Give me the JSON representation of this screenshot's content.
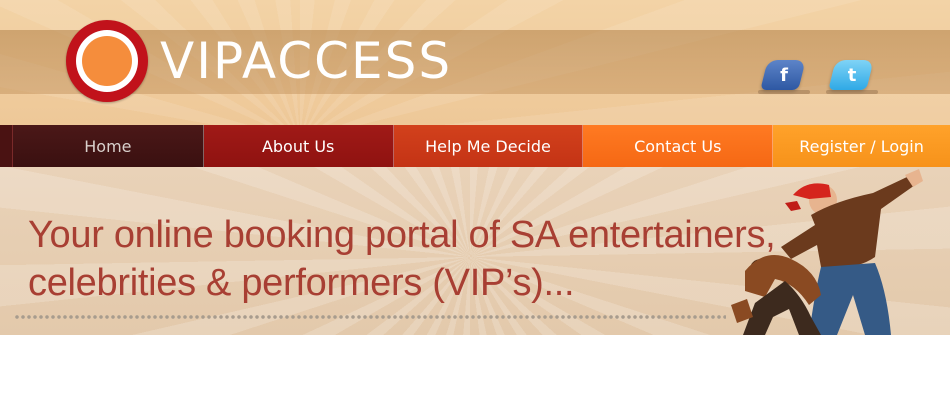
{
  "brand": {
    "logo_text": "VIPACCESS"
  },
  "social": {
    "facebook_glyph": "f",
    "twitter_glyph": "t"
  },
  "nav": {
    "items": [
      {
        "label": "Home"
      },
      {
        "label": "About Us"
      },
      {
        "label": "Help Me Decide"
      },
      {
        "label": "Contact Us"
      },
      {
        "label": "Register / Login"
      }
    ]
  },
  "banner": {
    "tagline_line1": "Your online booking portal of SA entertainers,",
    "tagline_line2": "celebrities & performers (VIP’s)..."
  },
  "colors": {
    "brand_red": "#c1121b",
    "brand_orange": "#f58d3c",
    "tagline": "#a83f33",
    "nav_home": "#3a1010",
    "nav_about": "#8f1210",
    "nav_help": "#c43315",
    "nav_contact": "#f56814",
    "nav_register": "#f7921a"
  }
}
